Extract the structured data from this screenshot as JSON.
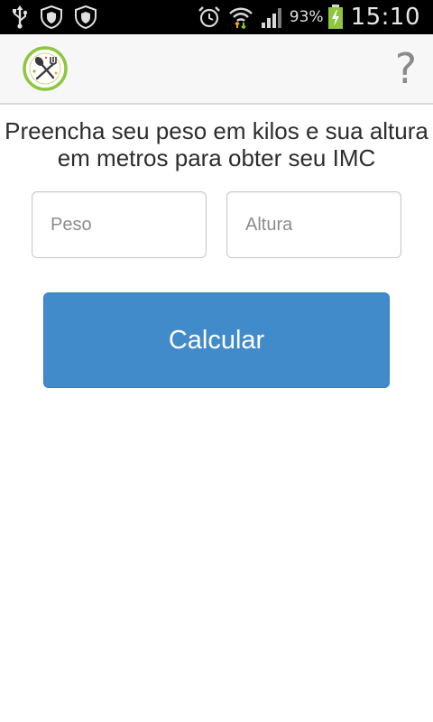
{
  "status_bar": {
    "battery_percent": "93%",
    "time": "15:10",
    "icons": [
      "usb-icon",
      "shield-icon",
      "shield-icon",
      "alarm-icon",
      "wifi-icon",
      "signal-icon",
      "battery-charging-icon"
    ]
  },
  "action_bar": {
    "logo": "fork-spoon-logo",
    "help_label": "?"
  },
  "form": {
    "instructions": "Preencha seu peso em kilos e sua altura em metros para obter seu IMC",
    "weight_placeholder": "Peso",
    "height_placeholder": "Altura",
    "weight_value": "",
    "height_value": "",
    "submit_label": "Calcular"
  },
  "colors": {
    "accent": "#428bca",
    "logo_ring": "#8dc63f",
    "status_bar_bg": "#000000",
    "battery_fill": "#8dc63f"
  }
}
